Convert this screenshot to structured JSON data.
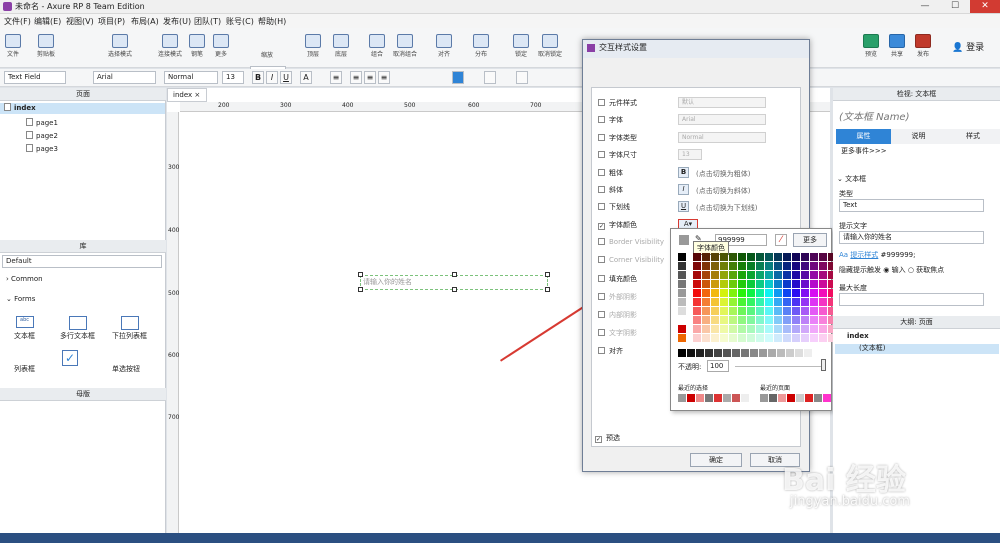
{
  "window": {
    "title": "未命名 - Axure RP 8 Team Edition",
    "min": "—",
    "max": "☐",
    "close": "✕"
  },
  "menu": [
    "文件(F)",
    "编辑(E)",
    "视图(V)",
    "项目(P)",
    "布局(A)",
    "发布(U)",
    "团队(T)",
    "账号(C)",
    "帮助(H)"
  ],
  "toolbar": {
    "file": "文件",
    "clipboard": "剪贴板",
    "select_mode": "选择模式",
    "connect": "连接模式",
    "pen": "钢笔",
    "more": "更多",
    "zoom_label": "缩放",
    "zoom": "100%",
    "top": "顶层",
    "bottom": "底层",
    "group": "组合",
    "ungroup": "取消组合",
    "align": "对齐",
    "distribute": "分布",
    "lock": "锁定",
    "unlock": "取消锁定",
    "preview": "预览",
    "share": "共享",
    "publish": "发布",
    "login": "登录"
  },
  "format": {
    "widget_type": "Text Field",
    "font": "Arial",
    "style": "Normal",
    "size": "13",
    "bold": "B",
    "italic": "I",
    "underline": "U"
  },
  "pages": {
    "title": "页面",
    "items": [
      "index",
      "page1",
      "page2",
      "page3"
    ]
  },
  "library": {
    "title": "库",
    "selected": "Default",
    "groups": [
      "Common",
      "Forms"
    ],
    "widgets": [
      "文本框",
      "多行文本框",
      "下拉列表框",
      "列表框",
      "复选框",
      "单选按钮"
    ]
  },
  "masters": {
    "title": "母版"
  },
  "canvas": {
    "tab": "index",
    "ruler_h": [
      "200",
      "300",
      "400",
      "500",
      "600",
      "700"
    ],
    "ruler_v": [
      "300",
      "400",
      "500",
      "600",
      "700"
    ],
    "placeholder": "请输入你的姓名"
  },
  "dialog": {
    "title": "交互样式设置",
    "rows": [
      {
        "label": "元件样式",
        "value": "默认",
        "type": "select",
        "checked": false,
        "disabled": false
      },
      {
        "label": "字体",
        "value": "Arial",
        "type": "select",
        "checked": false,
        "disabled": false
      },
      {
        "label": "字体类型",
        "value": "Normal",
        "type": "select",
        "checked": false,
        "disabled": false
      },
      {
        "label": "字体尺寸",
        "value": "13",
        "type": "select",
        "checked": false,
        "disabled": false
      },
      {
        "label": "粗体",
        "btn": "B",
        "desc": "(点击切换为粗体)",
        "type": "btn",
        "checked": false,
        "disabled": false
      },
      {
        "label": "斜体",
        "btn": "I",
        "desc": "(点击切换为斜体)",
        "type": "btn",
        "checked": false,
        "disabled": false
      },
      {
        "label": "下划线",
        "btn": "U",
        "desc": "(点击切换为下划线)",
        "type": "btn",
        "checked": false,
        "disabled": false
      },
      {
        "label": "字体颜色",
        "btn": "A",
        "type": "btn",
        "checked": true,
        "disabled": false
      },
      {
        "label": "Border Visibility",
        "type": "none",
        "checked": false,
        "disabled": true
      },
      {
        "label": "Corner Visibility",
        "type": "none",
        "checked": false,
        "disabled": true
      },
      {
        "label": "填充颜色",
        "type": "none",
        "checked": false,
        "disabled": false
      },
      {
        "label": "外部阴影",
        "type": "none",
        "checked": false,
        "disabled": true
      },
      {
        "label": "内部阴影",
        "type": "none",
        "checked": false,
        "disabled": true
      },
      {
        "label": "文字阴影",
        "type": "none",
        "checked": false,
        "disabled": true
      },
      {
        "label": "对齐",
        "type": "none",
        "checked": false,
        "disabled": false
      }
    ],
    "preview": "预选",
    "ok": "确定",
    "cancel": "取消"
  },
  "picker": {
    "hex": "999999",
    "more": "更多",
    "tooltip": "字体颜色",
    "opacity_label": "不透明:",
    "opacity": "100",
    "recent": "最近的选择",
    "recent_page": "最近的页面"
  },
  "inspector": {
    "title": "检视: 文本框",
    "name_placeholder": "(文本框 Name)",
    "tabs": [
      "属性",
      "说明",
      "样式"
    ],
    "more_events": "更多事件>>>",
    "section": "文本框",
    "type_label": "类型",
    "type_value": "Text",
    "hint_label": "提示文字",
    "hint_value": "请输入你的姓名",
    "hint_style_link": "提示样式",
    "hint_color": "#999999;",
    "hide_label": "隐藏提示触发",
    "input_opt": "输入",
    "focus_opt": "获取焦点",
    "maxlen_label": "最大长度"
  },
  "outline": {
    "title": "大纲: 页面",
    "root": "index",
    "child": "(文本框)"
  },
  "watermark": {
    "brand": "Bai 经验",
    "url": "jingyan.baidu.com"
  },
  "colors": {
    "accent": "#2f84d6",
    "select": "#cce4f7",
    "arrow": "#d73a32"
  }
}
